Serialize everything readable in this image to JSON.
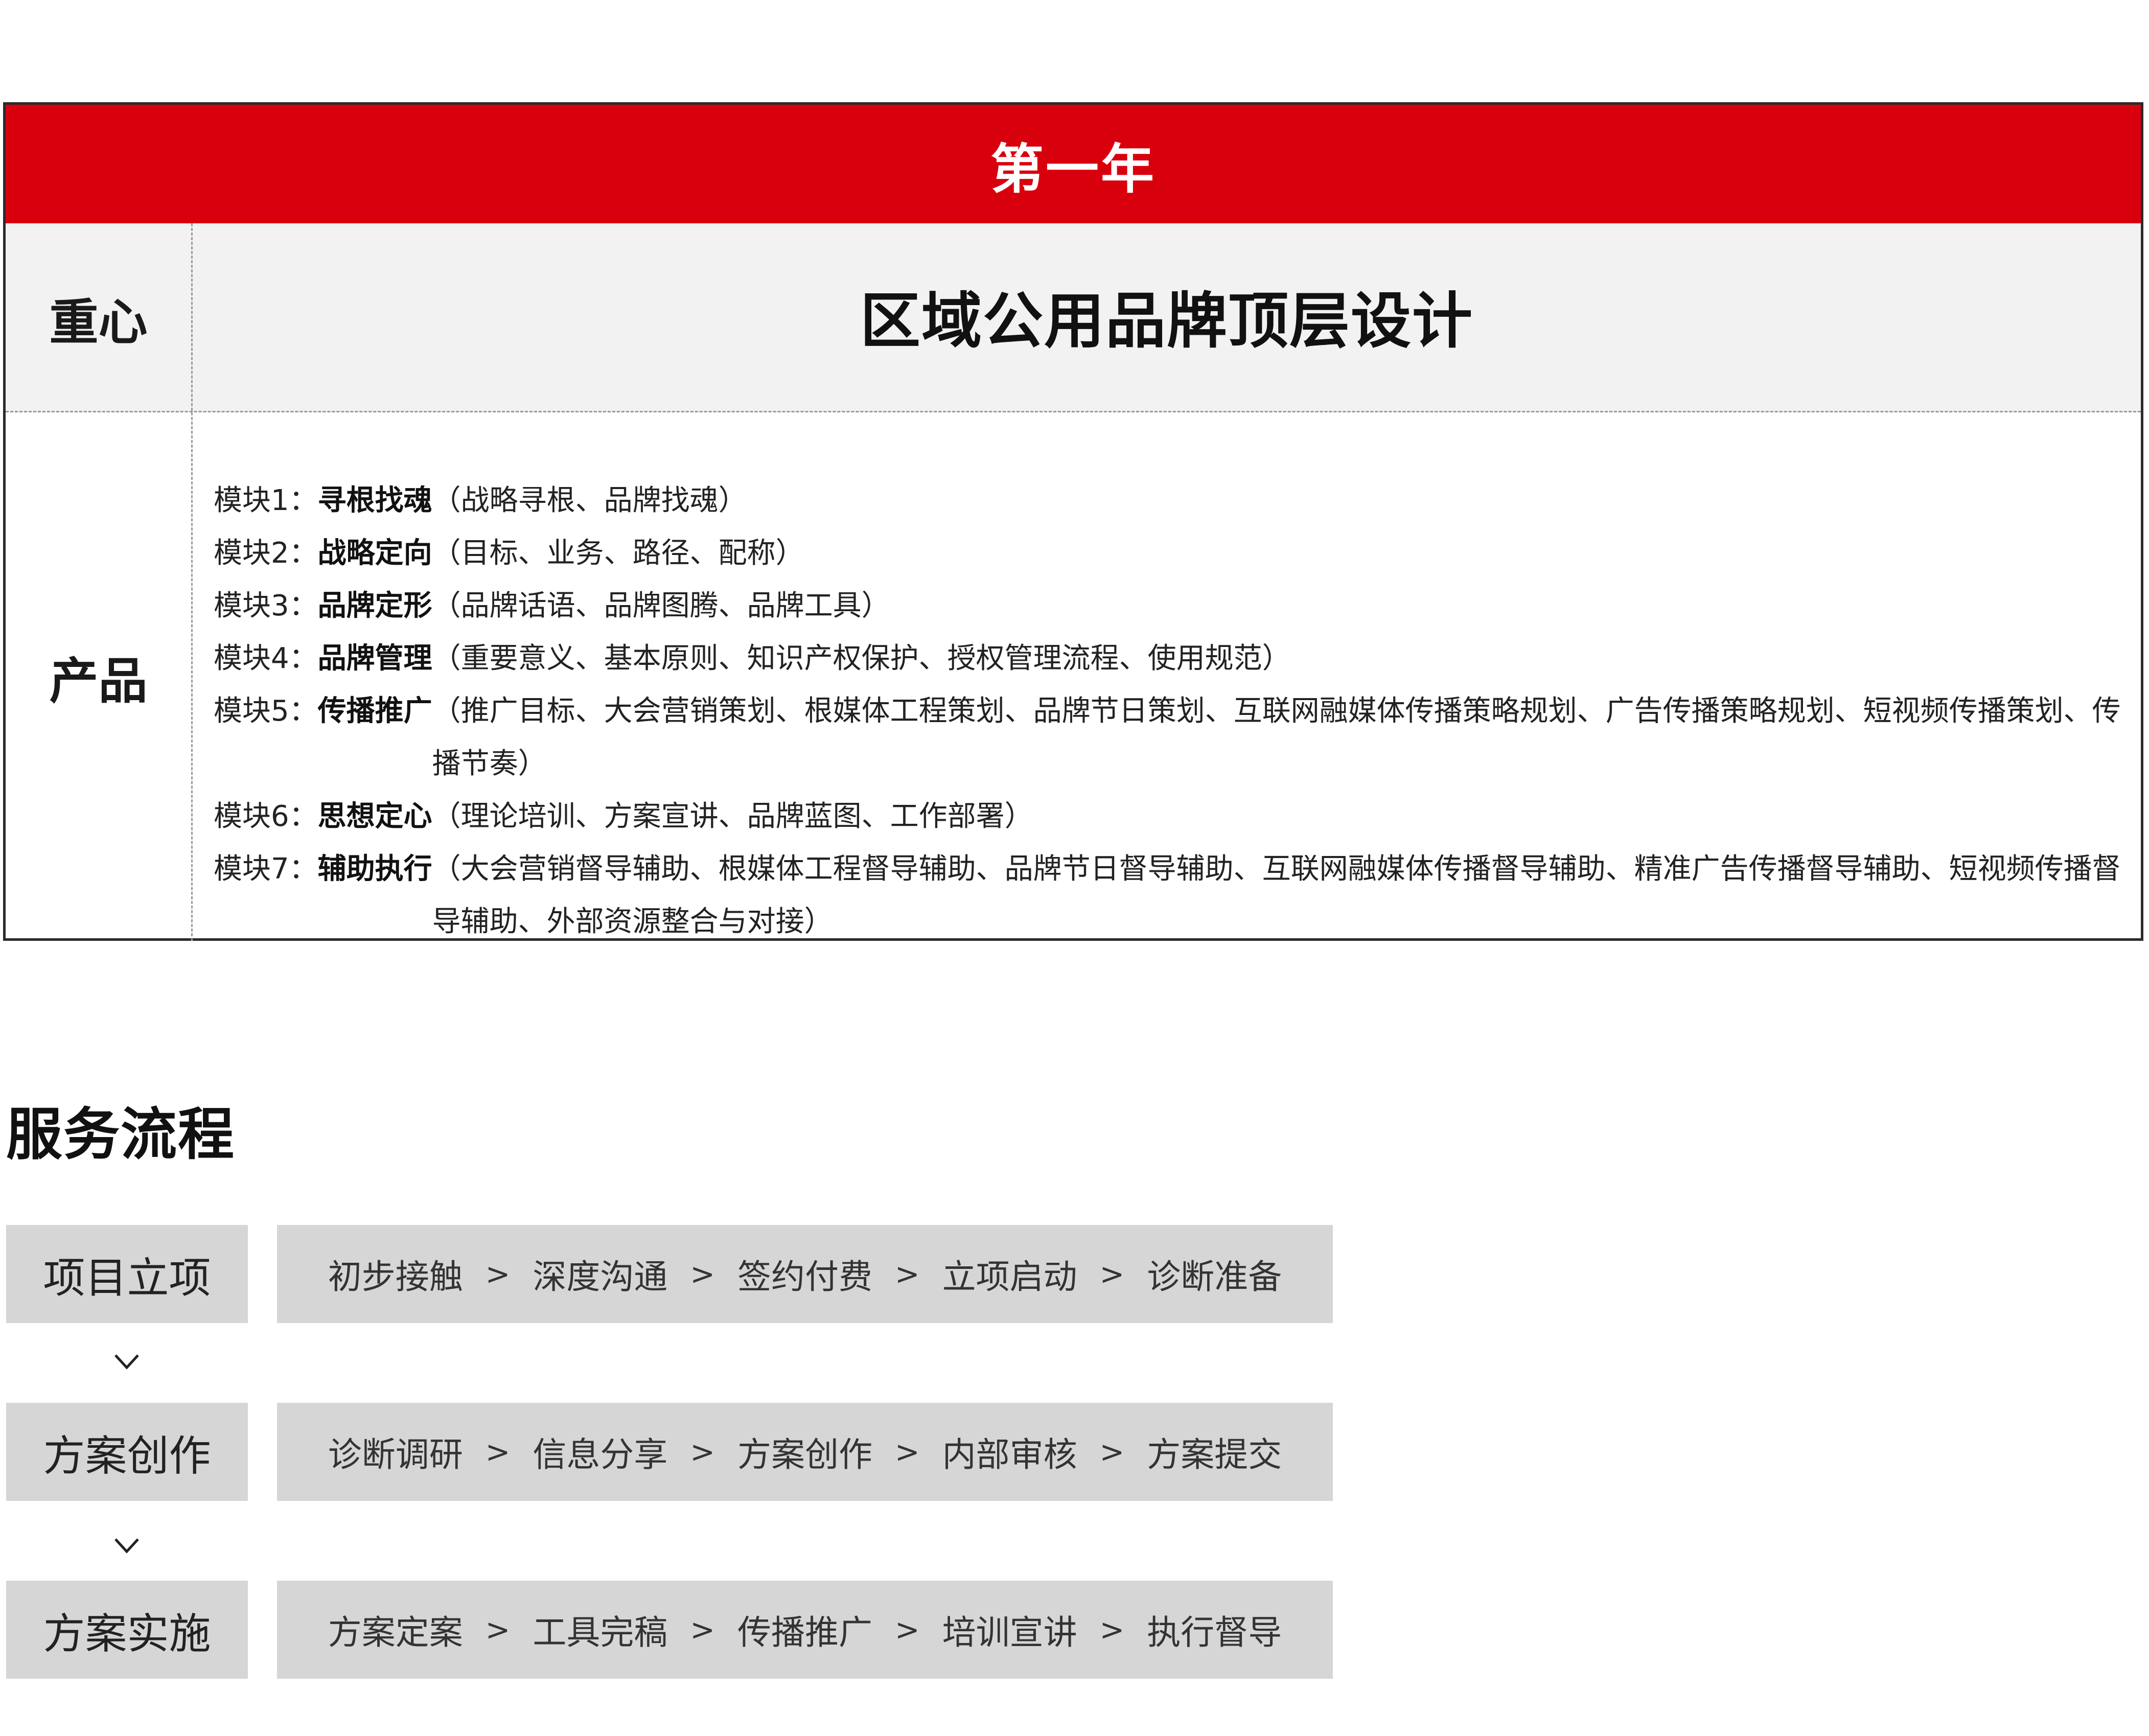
{
  "year": {
    "title": "第一年"
  },
  "focus": {
    "label": "重心",
    "value": "区域公用品牌顶层设计"
  },
  "product": {
    "label": "产品",
    "modules": [
      {
        "prefix": "模块1：",
        "name": "寻根找魂",
        "desc": "（战略寻根、品牌找魂）"
      },
      {
        "prefix": "模块2：",
        "name": "战略定向",
        "desc": "（目标、业务、路径、配称）"
      },
      {
        "prefix": "模块3：",
        "name": "品牌定形",
        "desc": "（品牌话语、品牌图腾、品牌工具）"
      },
      {
        "prefix": "模块4：",
        "name": "品牌管理",
        "desc": "（重要意义、基本原则、知识产权保护、授权管理流程、使用规范）"
      },
      {
        "prefix": "模块5：",
        "name": "传播推广",
        "desc": "（推广目标、大会营销策划、根媒体工程策划、品牌节日策划、互联网融媒体传播策略规划、广告传播策略规划、短视频传播策划、传播节奏）"
      },
      {
        "prefix": "模块6：",
        "name": "思想定心",
        "desc": "（理论培训、方案宣讲、品牌蓝图、工作部署）"
      },
      {
        "prefix": "模块7：",
        "name": "辅助执行",
        "desc": "（大会营销督导辅助、根媒体工程督导辅助、品牌节日督导辅助、互联网融媒体传播督导辅助、精准广告传播督导辅助、短视频传播督导辅助、外部资源整合与对接）"
      }
    ]
  },
  "process": {
    "title": "服务流程",
    "separator": ">",
    "stages": [
      {
        "name": "项目立项",
        "steps": [
          "初步接触",
          "深度沟通",
          "签约付费",
          "立项启动",
          "诊断准备"
        ]
      },
      {
        "name": "方案创作",
        "steps": [
          "诊断调研",
          "信息分享",
          "方案创作",
          "内部审核",
          "方案提交"
        ]
      },
      {
        "name": "方案实施",
        "steps": [
          "方案定案",
          "工具完稿",
          "传播推广",
          "培训宣讲",
          "执行督导"
        ]
      }
    ]
  },
  "colors": {
    "header_red": "#d9000e",
    "focus_bg": "#f2f2f2",
    "process_box": "#d6d6d6"
  }
}
